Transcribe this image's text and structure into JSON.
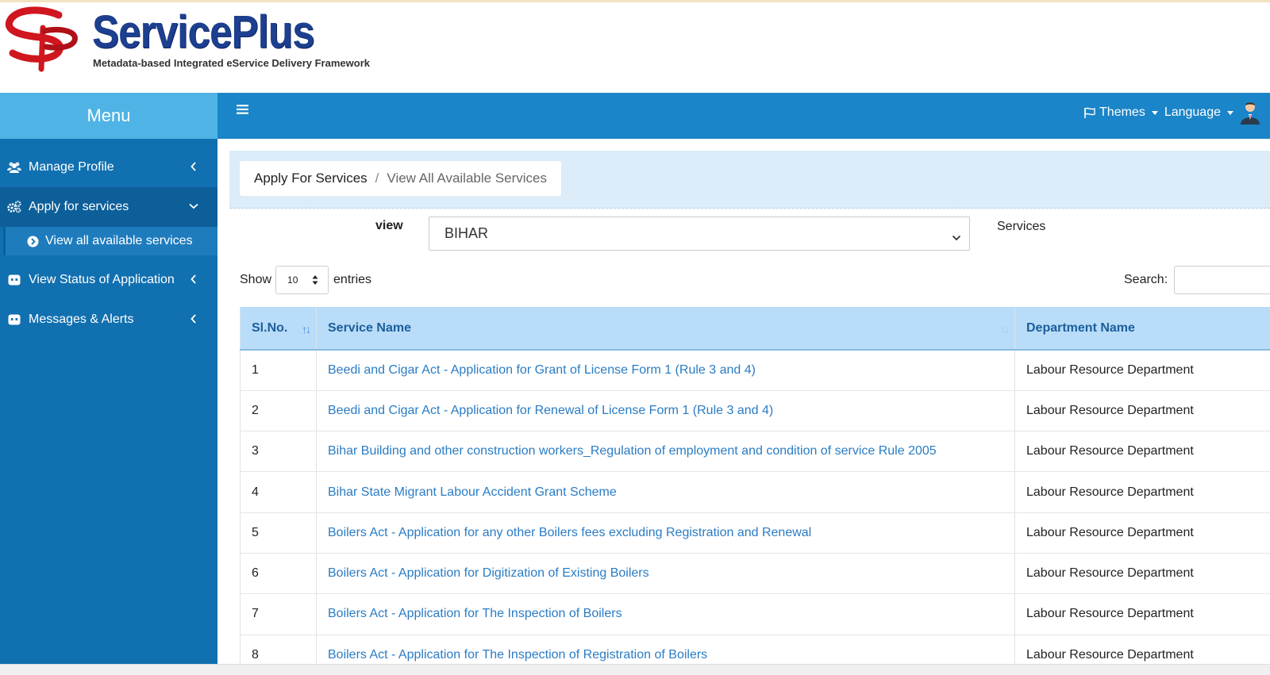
{
  "brand": {
    "title": "ServicePlus",
    "subtitle": "Metadata-based Integrated eService Delivery Framework"
  },
  "sidebar": {
    "menu_label": "Menu",
    "items": [
      {
        "label": "Manage Profile",
        "icon": "users-icon"
      },
      {
        "label": "Apply for services",
        "icon": "cogs-icon"
      },
      {
        "label": "View Status of Application",
        "icon": "app-icon"
      },
      {
        "label": "Messages & Alerts",
        "icon": "app-icon"
      }
    ],
    "sub_item": {
      "label": "View all available services",
      "icon": "chevron-circle-right-icon"
    }
  },
  "topnav": {
    "themes_label": "Themes",
    "language_label": "Language"
  },
  "breadcrumb": {
    "parent": "Apply For Services",
    "separator": "/",
    "current": "View All Available Services"
  },
  "filter": {
    "view_label": "view",
    "state_value": "BIHAR",
    "services_label": "Services"
  },
  "table_controls": {
    "show_label": "Show",
    "entries_value": "10",
    "entries_label": "entries",
    "search_label": "Search:"
  },
  "table": {
    "headers": [
      "Sl.No.",
      "Service Name",
      "Department Name"
    ],
    "rows": [
      {
        "no": "1",
        "service": "Beedi and Cigar Act - Application for Grant of License Form 1 (Rule 3 and 4)",
        "dept": "Labour Resource Department"
      },
      {
        "no": "2",
        "service": "Beedi and Cigar Act - Application for Renewal of License Form 1 (Rule 3 and 4)",
        "dept": "Labour Resource Department"
      },
      {
        "no": "3",
        "service": "Bihar Building and other construction workers_Regulation of employment and condition of service Rule 2005",
        "dept": "Labour Resource Department"
      },
      {
        "no": "4",
        "service": "Bihar State Migrant Labour Accident Grant Scheme",
        "dept": "Labour Resource Department"
      },
      {
        "no": "5",
        "service": "Boilers Act - Application for any other Boilers fees excluding Registration and Renewal",
        "dept": "Labour Resource Department"
      },
      {
        "no": "6",
        "service": "Boilers Act - Application for Digitization of Existing Boilers",
        "dept": "Labour Resource Department"
      },
      {
        "no": "7",
        "service": "Boilers Act - Application for The Inspection of Boilers",
        "dept": "Labour Resource Department"
      },
      {
        "no": "8",
        "service": "Boilers Act - Application for The Inspection of Registration of Boilers",
        "dept": "Labour Resource Department"
      }
    ]
  },
  "colors": {
    "sidebar": "#1170b0",
    "menu_header": "#4fb3e6",
    "topnav": "#1a85c8",
    "table_header": "#b9dcf8",
    "link": "#2a7cc4",
    "brand_blue": "#1d3f8f",
    "brand_red": "#d0161e"
  }
}
